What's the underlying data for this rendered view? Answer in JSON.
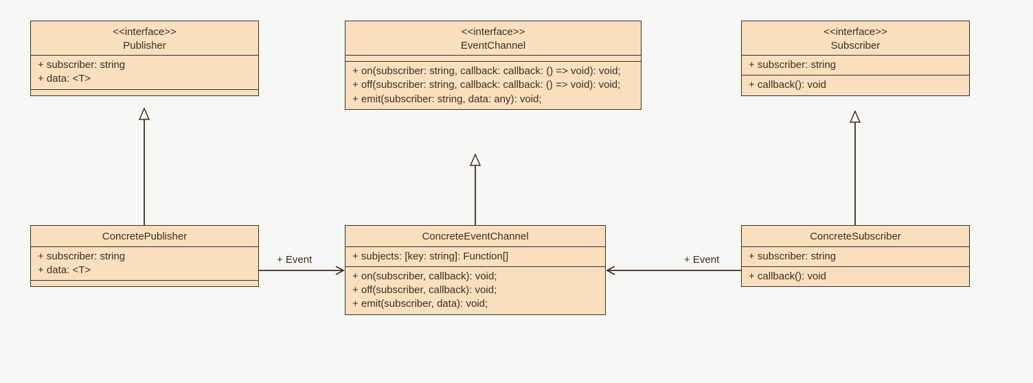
{
  "classes": {
    "publisher": {
      "stereotype": "<<interface>>",
      "name": "Publisher",
      "attrs": [
        "+ subscriber: string",
        "+ data: <T>"
      ],
      "methods": []
    },
    "eventChannel": {
      "stereotype": "<<interface>>",
      "name": "EventChannel",
      "attrs": [],
      "methods": [
        "+ on(subscriber: string, callback: callback: () => void): void;",
        "+ off(subscriber: string, callback: callback: () => void): void;",
        "+ emit(subscriber: string, data: any): void;"
      ]
    },
    "subscriber": {
      "stereotype": "<<interface>>",
      "name": "Subscriber",
      "attrs": [
        "+ subscriber: string"
      ],
      "methods": [
        "+ callback(): void"
      ]
    },
    "concretePublisher": {
      "name": "ConcretePublisher",
      "attrs": [
        "+ subscriber: string",
        "+ data: <T>"
      ],
      "methods": []
    },
    "concreteEventChannel": {
      "name": "ConcreteEventChannel",
      "attrs": [
        "+ subjects: [key: string]: Function[]"
      ],
      "methods": [
        "+ on(subscriber, callback): void;",
        "+ off(subscriber, callback): void;",
        "+ emit(subscriber, data): void;"
      ]
    },
    "concreteSubscriber": {
      "name": "ConcreteSubscriber",
      "attrs": [
        "+ subscriber: string"
      ],
      "methods": [
        "+ callback(): void"
      ]
    }
  },
  "edges": {
    "pubEvent": "+ Event",
    "subEvent": "+ Event"
  }
}
